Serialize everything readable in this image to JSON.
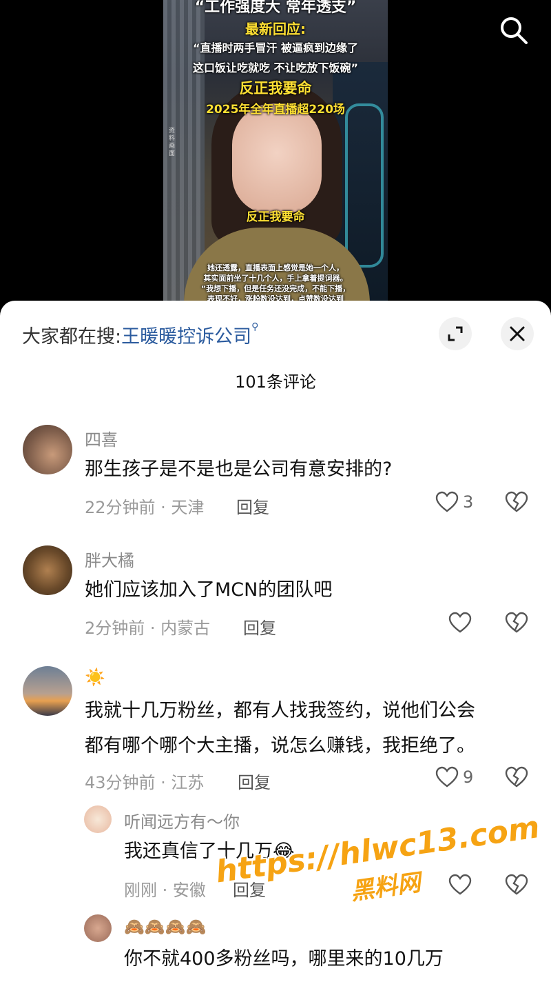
{
  "video": {
    "caption_top": "“工作强度大 常年透支”",
    "caption_latest": "最新回应:",
    "quote_line1": "“直播时两手冒汗 被逼疯到边缘了",
    "quote_line2": "这口饭让吃就吃 不让吃放下饭碗”",
    "caption_risk": "反正我要命",
    "caption_stats": "2025年全年直播超220场",
    "side_note": "资料画面",
    "subtitle": "反正我要命",
    "bottom_line1": "她还透露，直播表面上感觉是她一个人，",
    "bottom_line2": "其实面前坐了十几个人，手上拿着提词器。",
    "bottom_line3": "“我想下播，但是任务还没完成，不能下播，",
    "bottom_line4": "表现不好，涨粉数没达到，点赞数没达到"
  },
  "sheet": {
    "hot_search_prefix": "大家都在搜:",
    "hot_search_keyword": "王暖暖控诉公司",
    "hot_search_icon": "search-mini-icon",
    "comment_count": "101条评论"
  },
  "comments": [
    {
      "user": "四喜",
      "text": "那生孩子是不是也是公司有意安排的?",
      "meta": "22分钟前 · 天津",
      "reply": "回复",
      "likes": "3"
    },
    {
      "user": "胖大橘",
      "text": "她们应该加入了MCN的团队吧",
      "meta": "2分钟前 · 内蒙古",
      "reply": "回复",
      "likes": ""
    },
    {
      "user": "☀️",
      "text_line1": "我就十几万粉丝，都有人找我签约，说他们公会",
      "text_line2": "都有哪个哪个大主播，说怎么赚钱，我拒绝了。",
      "meta": "43分钟前 · 江苏",
      "reply": "回复",
      "likes": "9"
    },
    {
      "user": "听闻远方有～你",
      "text": "我还真信了十几万😂",
      "meta": "刚刚 · 安徽",
      "reply": "回复",
      "likes": ""
    },
    {
      "user": "🙈🙈🙈🙈",
      "text": "你不就400多粉丝吗，哪里来的10几万"
    }
  ],
  "watermark": {
    "url": "https://hlwc13.com",
    "name": "黑料网"
  }
}
